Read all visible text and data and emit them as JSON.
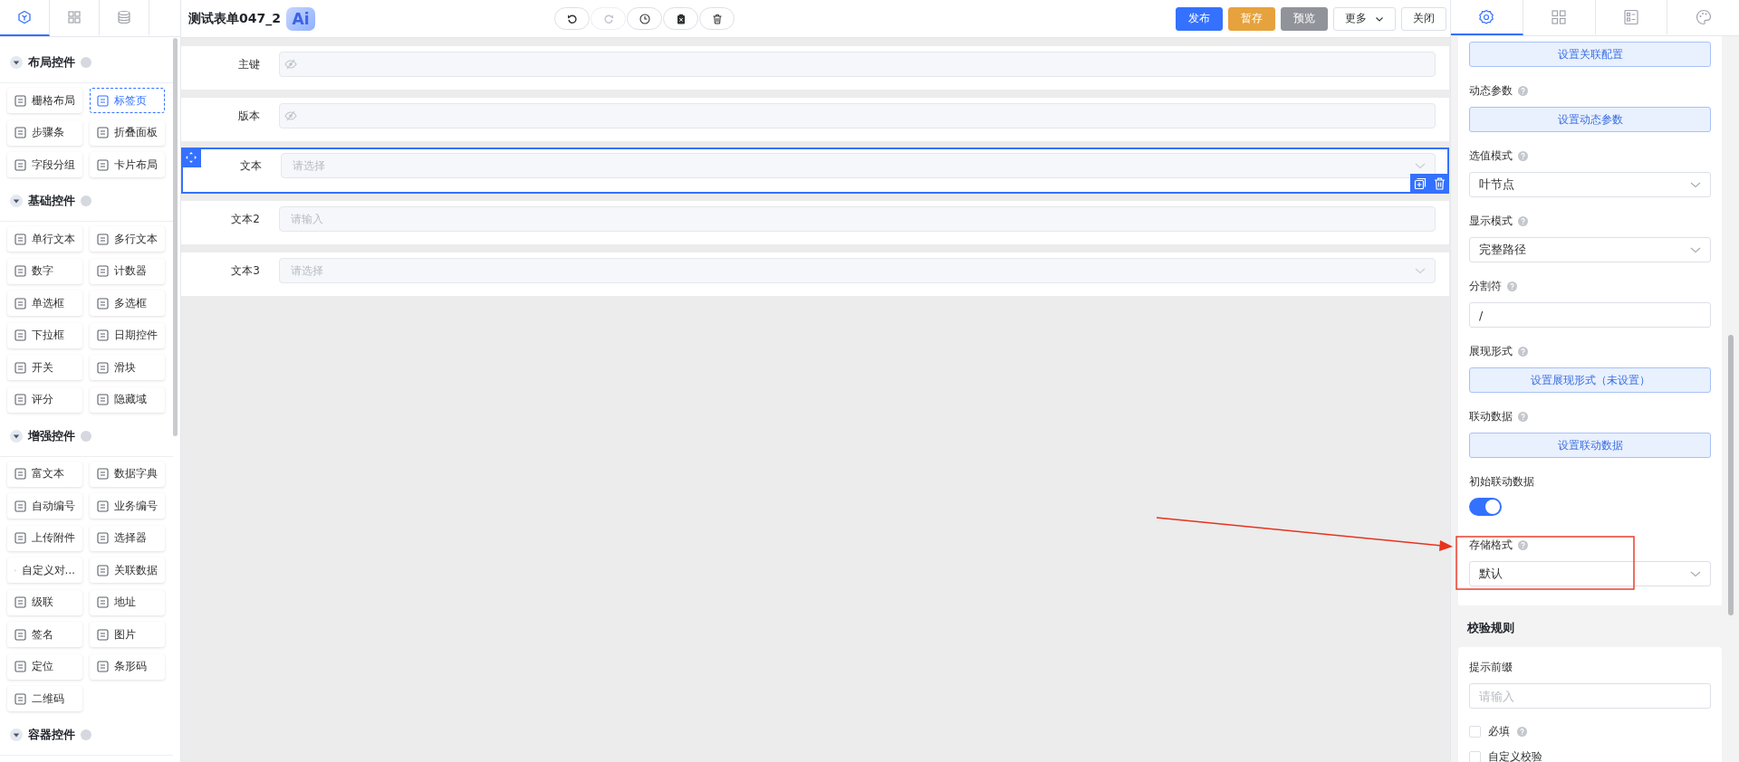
{
  "left_tabs": [
    {
      "kind": "cube",
      "selected": true
    },
    {
      "kind": "grid",
      "selected": false
    },
    {
      "kind": "database",
      "selected": false
    }
  ],
  "sections": [
    {
      "title": "布局控件",
      "expanded": true,
      "items": [
        {
          "label": "栅格布局",
          "selected": false
        },
        {
          "label": "标签页",
          "selected": true
        },
        {
          "label": "步骤条",
          "selected": false
        },
        {
          "label": "折叠面板",
          "selected": false
        },
        {
          "label": "字段分组",
          "selected": false
        },
        {
          "label": "卡片布局",
          "selected": false
        }
      ]
    },
    {
      "title": "基础控件",
      "expanded": true,
      "items": [
        {
          "label": "单行文本",
          "selected": false
        },
        {
          "label": "多行文本",
          "selected": false
        },
        {
          "label": "数字",
          "selected": false
        },
        {
          "label": "计数器",
          "selected": false
        },
        {
          "label": "单选框",
          "selected": false
        },
        {
          "label": "多选框",
          "selected": false
        },
        {
          "label": "下拉框",
          "selected": false
        },
        {
          "label": "日期控件",
          "selected": false
        },
        {
          "label": "开关",
          "selected": false
        },
        {
          "label": "滑块",
          "selected": false
        },
        {
          "label": "评分",
          "selected": false
        },
        {
          "label": "隐藏域",
          "selected": false
        }
      ]
    },
    {
      "title": "增强控件",
      "expanded": true,
      "items": [
        {
          "label": "富文本",
          "selected": false
        },
        {
          "label": "数据字典",
          "selected": false
        },
        {
          "label": "自动编号",
          "selected": false
        },
        {
          "label": "业务编号",
          "selected": false
        },
        {
          "label": "上传附件",
          "selected": false
        },
        {
          "label": "选择器",
          "selected": false
        },
        {
          "label": "自定义对…",
          "selected": false
        },
        {
          "label": "关联数据",
          "selected": false
        },
        {
          "label": "级联",
          "selected": false
        },
        {
          "label": "地址",
          "selected": false
        },
        {
          "label": "签名",
          "selected": false
        },
        {
          "label": "图片",
          "selected": false
        },
        {
          "label": "定位",
          "selected": false
        },
        {
          "label": "条形码",
          "selected": false
        },
        {
          "label": "二维码",
          "selected": false
        }
      ]
    },
    {
      "title": "容器控件",
      "expanded": true
    }
  ],
  "header": {
    "title": "测试表单047_2",
    "ai_badge": "Ai",
    "tools": [
      {
        "kind": "undo",
        "disabled": false
      },
      {
        "kind": "redo",
        "disabled": true
      },
      {
        "kind": "history",
        "disabled": false
      },
      {
        "kind": "clear",
        "disabled": false
      },
      {
        "kind": "delete",
        "disabled": false
      }
    ],
    "buttons": [
      {
        "label": "发布",
        "kind": "primary",
        "caret": false
      },
      {
        "label": "暂存",
        "kind": "warning",
        "caret": false
      },
      {
        "label": "预览",
        "kind": "info",
        "caret": false
      },
      {
        "label": "更多",
        "kind": "default",
        "caret": true
      },
      {
        "label": "关闭",
        "kind": "default",
        "caret": false
      }
    ]
  },
  "form_rows": [
    {
      "label": "主键",
      "kind": "hidden",
      "selected": false
    },
    {
      "label": "版本",
      "kind": "hidden",
      "selected": false
    },
    {
      "label": "文本",
      "kind": "select",
      "placeholder": "请选择",
      "selected": true
    },
    {
      "label": "文本2",
      "kind": "input",
      "placeholder": "请输入",
      "selected": false
    },
    {
      "label": "文本3",
      "kind": "select",
      "placeholder": "请选择",
      "selected": false
    }
  ],
  "right_tabs": [
    {
      "kind": "settings",
      "selected": true
    },
    {
      "kind": "grid",
      "selected": false
    },
    {
      "kind": "form",
      "selected": false
    },
    {
      "kind": "palette",
      "selected": false
    }
  ],
  "property_groups": [
    {
      "items": [
        {
          "kind": "button",
          "text": "设置关联配置"
        },
        {
          "kind": "button",
          "label": "动态参数",
          "help": true,
          "text": "设置动态参数"
        },
        {
          "kind": "select",
          "label": "选值模式",
          "help": true,
          "value": "叶节点"
        },
        {
          "kind": "select",
          "label": "显示模式",
          "help": true,
          "value": "完整路径"
        },
        {
          "kind": "input",
          "label": "分割符",
          "help": true,
          "value": "/"
        },
        {
          "kind": "button",
          "label": "展现形式",
          "help": true,
          "text": "设置展现形式（未设置）"
        },
        {
          "kind": "button",
          "label": "联动数据",
          "help": true,
          "text": "设置联动数据"
        },
        {
          "kind": "switch",
          "label": "初始联动数据",
          "help": false,
          "on": true
        },
        {
          "kind": "select",
          "label": "存储格式",
          "help": true,
          "value": "默认"
        }
      ]
    },
    {
      "title": "校验规则",
      "items": [
        {
          "kind": "input",
          "label": "提示前缀",
          "help": false,
          "placeholder": "请输入"
        },
        {
          "kind": "checkbox",
          "label": "必填",
          "help": true,
          "checked": false
        },
        {
          "kind": "checkbox",
          "label": "自定义校验",
          "help": false,
          "checked": false
        }
      ]
    }
  ]
}
